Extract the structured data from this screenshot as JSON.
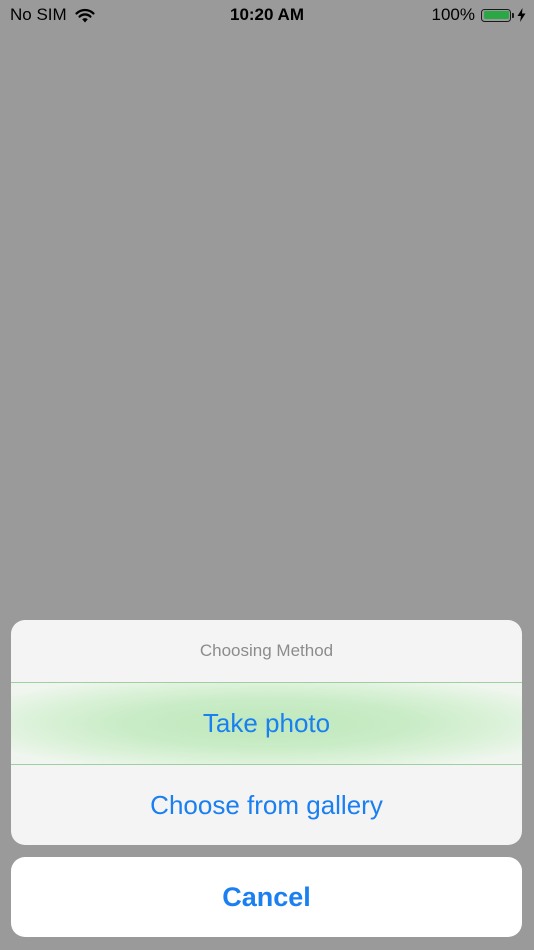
{
  "status_bar": {
    "carrier": "No SIM",
    "time": "10:20 AM",
    "battery_percent": "100%",
    "battery_level": 1.0,
    "battery_color": "#2aa845",
    "icons": [
      "wifi-icon",
      "battery-icon",
      "charging-bolt-icon"
    ]
  },
  "action_sheet": {
    "title": "Choosing Method",
    "options": [
      {
        "label": "Take photo"
      },
      {
        "label": "Choose from gallery"
      }
    ],
    "cancel_label": "Cancel",
    "accent_color": "#1a7ff0"
  }
}
